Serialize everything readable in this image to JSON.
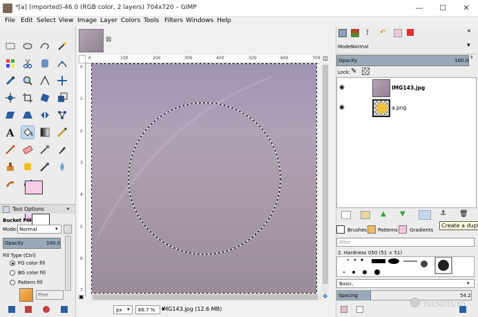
{
  "window": {
    "title": "*[a] (imported)-46.0 (RGB color, 2 layers) 704x720 – GIMP",
    "minimize": "—",
    "maximize": "☐",
    "close": "✕"
  },
  "menu": [
    "File",
    "Edit",
    "Select",
    "View",
    "Image",
    "Layer",
    "Colors",
    "Tools",
    "Filters",
    "Windows",
    "Help"
  ],
  "image_tab": {
    "close": "⊠"
  },
  "rulers": {
    "top": [
      "0",
      "100",
      "200",
      "300",
      "400",
      "500",
      "600",
      "700"
    ],
    "left": [
      "0",
      "1",
      "2",
      "3",
      "4",
      "5",
      "6",
      "7"
    ]
  },
  "tool_options": {
    "tab_label": "Tool Options",
    "title": "Bucket Fill",
    "mode_label": "Mode:",
    "mode_value": "Normal",
    "opacity_label": "Opacity",
    "opacity_value": "100.0",
    "fill_type_label": "Fill Type  (Ctrl)",
    "fill_options": [
      "FG color fill",
      "BG color fill",
      "Pattern fill"
    ],
    "pattern_name": "Pine"
  },
  "status": {
    "unit": "px",
    "zoom": "66.7 %",
    "info": "IMG143.jpg (12.6 MB)"
  },
  "layers": {
    "mode_label": "Mode:",
    "mode_value": "Normal",
    "opacity_label": "Opacity",
    "opacity_value": "100.0",
    "lock_label": "Lock:",
    "items": [
      {
        "name": "IMG143.jpg"
      },
      {
        "name": "a.png"
      }
    ]
  },
  "tooltip": "Create a duplic",
  "brushes": {
    "tabs": [
      "Brushes",
      "Patterns",
      "Gradients"
    ],
    "filter_placeholder": "filter",
    "current": "2. Hardness 050 (51 × 51)",
    "preset": "Basic,",
    "spacing_label": "Spacing",
    "spacing_value": "54.2"
  },
  "watermark": "TECNOTUTO"
}
